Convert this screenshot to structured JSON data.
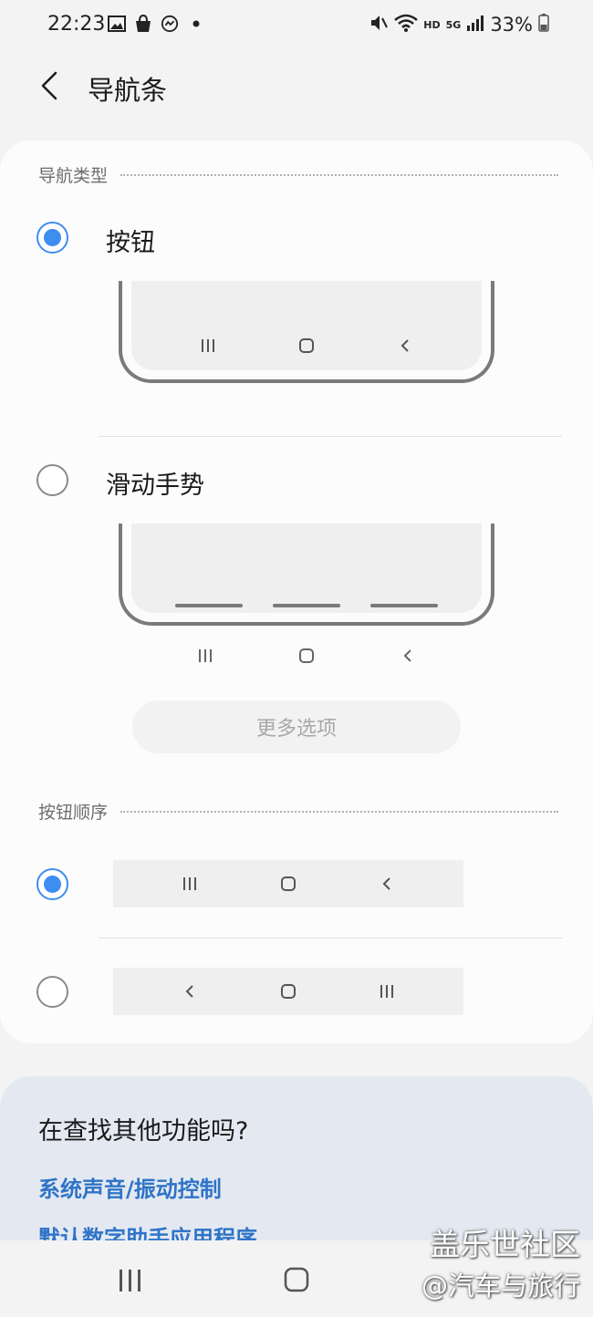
{
  "status_bar": {
    "time": "22:23",
    "battery": "33%",
    "left_icons": [
      "gallery-icon",
      "shopping-bag-icon",
      "messenger-icon",
      "dot-icon"
    ],
    "right_icons": [
      "mute-vibrate-icon",
      "wifi-icon",
      "hd-icon",
      "5g-icon",
      "signal-icon",
      "battery-icon"
    ]
  },
  "header": {
    "title": "导航条"
  },
  "navigation_type": {
    "section_title": "导航类型",
    "options": [
      {
        "label": "按钮",
        "selected": true
      },
      {
        "label": "滑动手势",
        "selected": false
      }
    ],
    "more_options": "更多选项"
  },
  "button_order": {
    "section_title": "按钮顺序",
    "options": [
      {
        "order": [
          "recents",
          "home",
          "back"
        ],
        "selected": true
      },
      {
        "order": [
          "back",
          "home",
          "recents"
        ],
        "selected": false
      }
    ]
  },
  "suggestions": {
    "title": "在查找其他功能吗?",
    "links": [
      "系统声音/振动控制",
      "默认数字助手应用程序"
    ]
  },
  "watermark": {
    "line1": "盖乐世社区",
    "line2": "@汽车与旅行"
  },
  "colors": {
    "accent": "#3e8df0",
    "link": "#2f74c8",
    "background": "#f3f3f4",
    "card": "#fcfcfc",
    "suggestion_bg": "#e4e9f1"
  }
}
